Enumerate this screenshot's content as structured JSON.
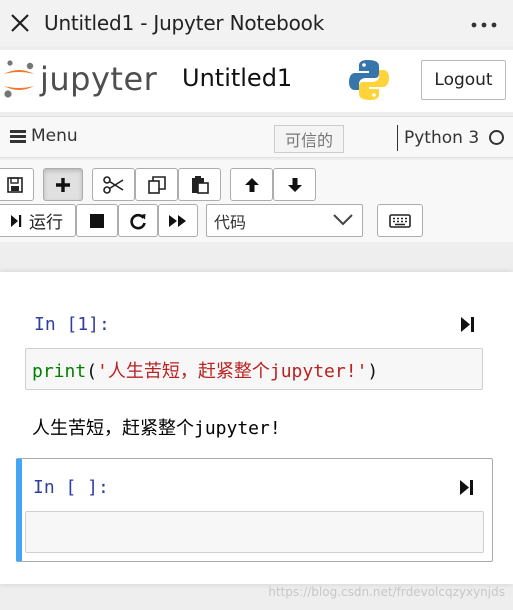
{
  "appbar": {
    "title": "Untitled1 - Jupyter Notebook",
    "close_icon": "close-icon",
    "more_label": "⋮"
  },
  "header": {
    "logo_text": "jupyter",
    "notebook_name": "Untitled1",
    "logout_label": "Logout"
  },
  "menubar": {
    "menu_label": "Menu",
    "trusted_label": "可信的",
    "kernel_name": "Python 3"
  },
  "toolbar": {
    "run_label": "运行",
    "cell_type": "代码",
    "icons": [
      "save-icon",
      "add-cell-icon",
      "cut-icon",
      "copy-icon",
      "paste-icon",
      "move-up-icon",
      "move-down-icon",
      "run-icon",
      "stop-icon",
      "restart-icon",
      "fast-forward-icon",
      "keyboard-icon"
    ]
  },
  "cells": [
    {
      "prompt": "In [1]:",
      "code_fn": "print",
      "code_open": "(",
      "code_str": "'人生苦短，赶紧整个jupyter!'",
      "code_close": ")",
      "output": "人生苦短，赶紧整个jupyter!"
    },
    {
      "prompt": "In [ ]:",
      "code": ""
    }
  ],
  "watermark": "https://blog.csdn.net/frdevolcqzyxynjds",
  "colors": {
    "prompt": "#303f9f",
    "selected_cell_border": "#42a5f5",
    "code_fn": "#008000",
    "code_str": "#ba2121"
  }
}
